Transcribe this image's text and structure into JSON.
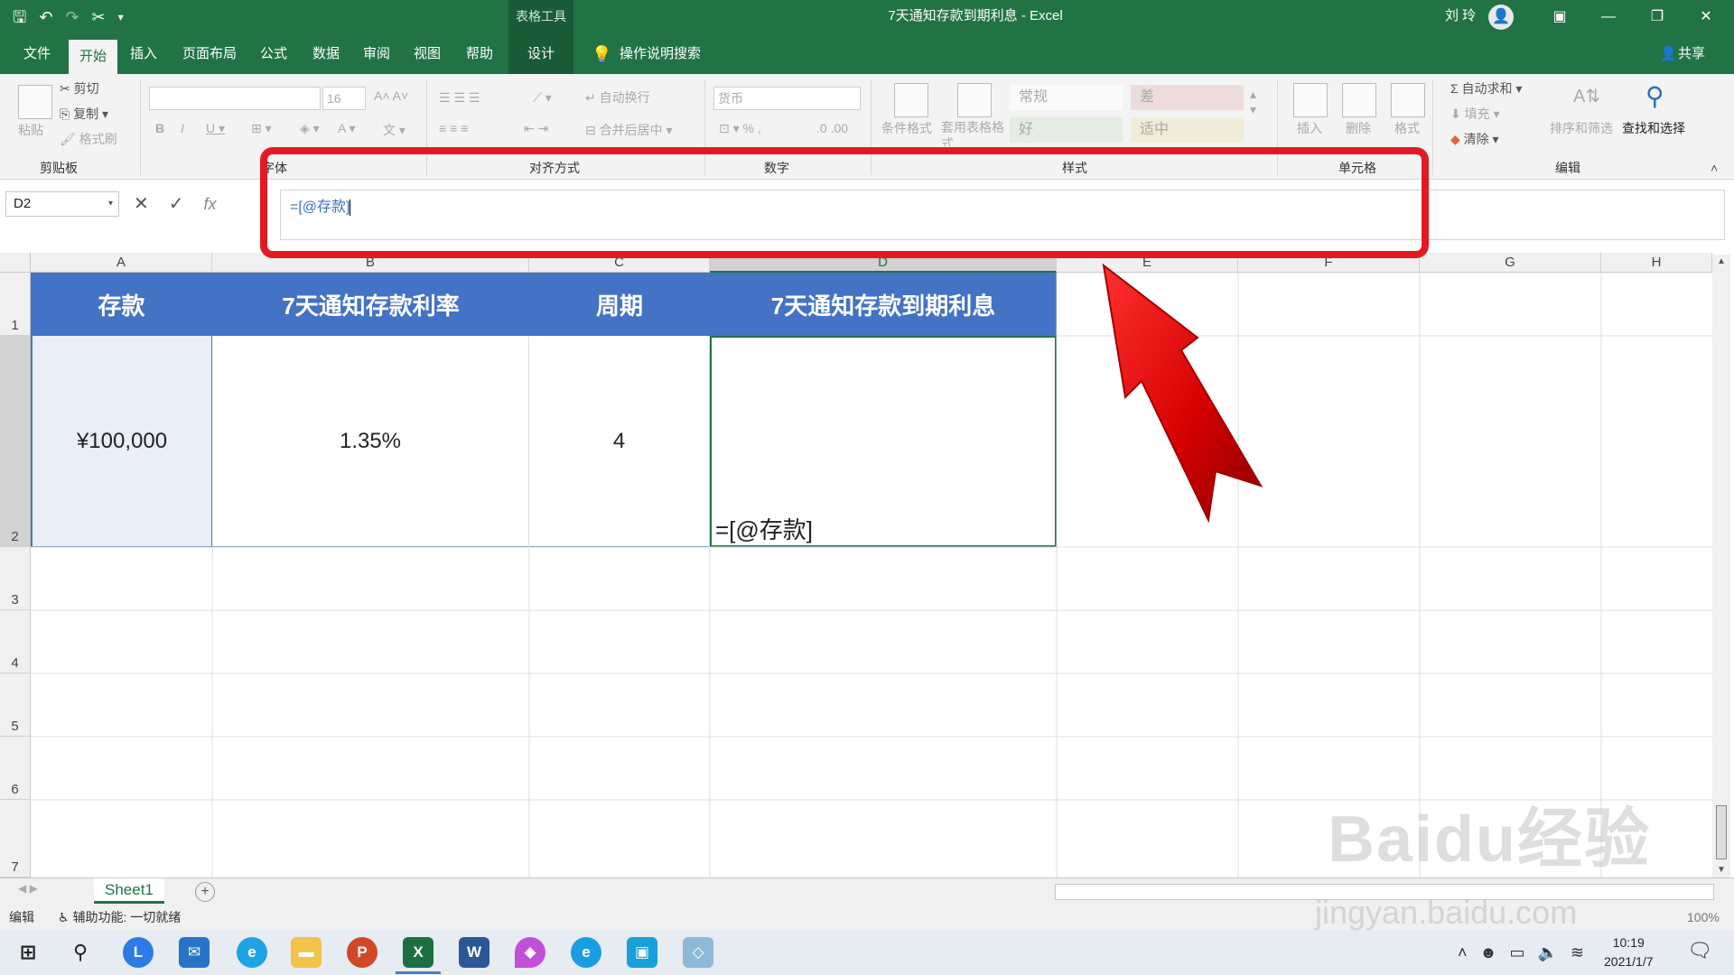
{
  "titlebar": {
    "context_tools": "表格工具",
    "window_title": "7天通知存款到期利息  -  Excel",
    "user_name": "刘 玲"
  },
  "menu": {
    "tabs": [
      "文件",
      "开始",
      "插入",
      "页面布局",
      "公式",
      "数据",
      "审阅",
      "视图",
      "帮助",
      "设计"
    ],
    "active_tab": "开始",
    "search_hint": "操作说明搜索",
    "share": "共享"
  },
  "ribbon": {
    "clipboard": {
      "paste": "粘贴",
      "cut": "剪切",
      "copy": "复制",
      "format_painter": "格式刷",
      "label": "剪贴板"
    },
    "font": {
      "size": "16",
      "label": "字体"
    },
    "alignment": {
      "wrap": "自动换行",
      "merge": "合并后居中",
      "label": "对齐方式"
    },
    "number": {
      "format": "货币",
      "label": "数字"
    },
    "styles": {
      "conditional": "条件格式",
      "table_format": "套用表格格式",
      "normal": "常规",
      "bad": "差",
      "good": "好",
      "neutral": "适中",
      "label": "样式"
    },
    "cells": {
      "insert": "插入",
      "delete": "删除",
      "format": "格式",
      "label": "单元格"
    },
    "editing": {
      "autosum": "自动求和",
      "fill": "填充",
      "clear": "清除",
      "sort": "排序和筛选",
      "find": "查找和选择",
      "label": "编辑"
    }
  },
  "formula_bar": {
    "name_box": "D2",
    "formula": "=[@存款]"
  },
  "sheet": {
    "columns": [
      "A",
      "B",
      "C",
      "D",
      "E",
      "F",
      "G",
      "H"
    ],
    "rows": [
      "1",
      "2",
      "3",
      "4",
      "5",
      "6",
      "7"
    ],
    "headers": [
      "存款",
      "7天通知存款利率",
      "周期",
      "7天通知存款到期利息"
    ],
    "row2": [
      "¥100,000",
      "1.35%",
      "4",
      "=[@存款]"
    ]
  },
  "sheet_tabs": {
    "active": "Sheet1"
  },
  "status": {
    "mode": "编辑",
    "accessibility": "辅助功能: 一切就绪",
    "zoom": "100%"
  },
  "taskbar": {
    "time": "10:19",
    "date": "2021/1/7"
  },
  "watermark": {
    "brand": "Baidu经验",
    "url": "jingyan.baidu.com"
  }
}
